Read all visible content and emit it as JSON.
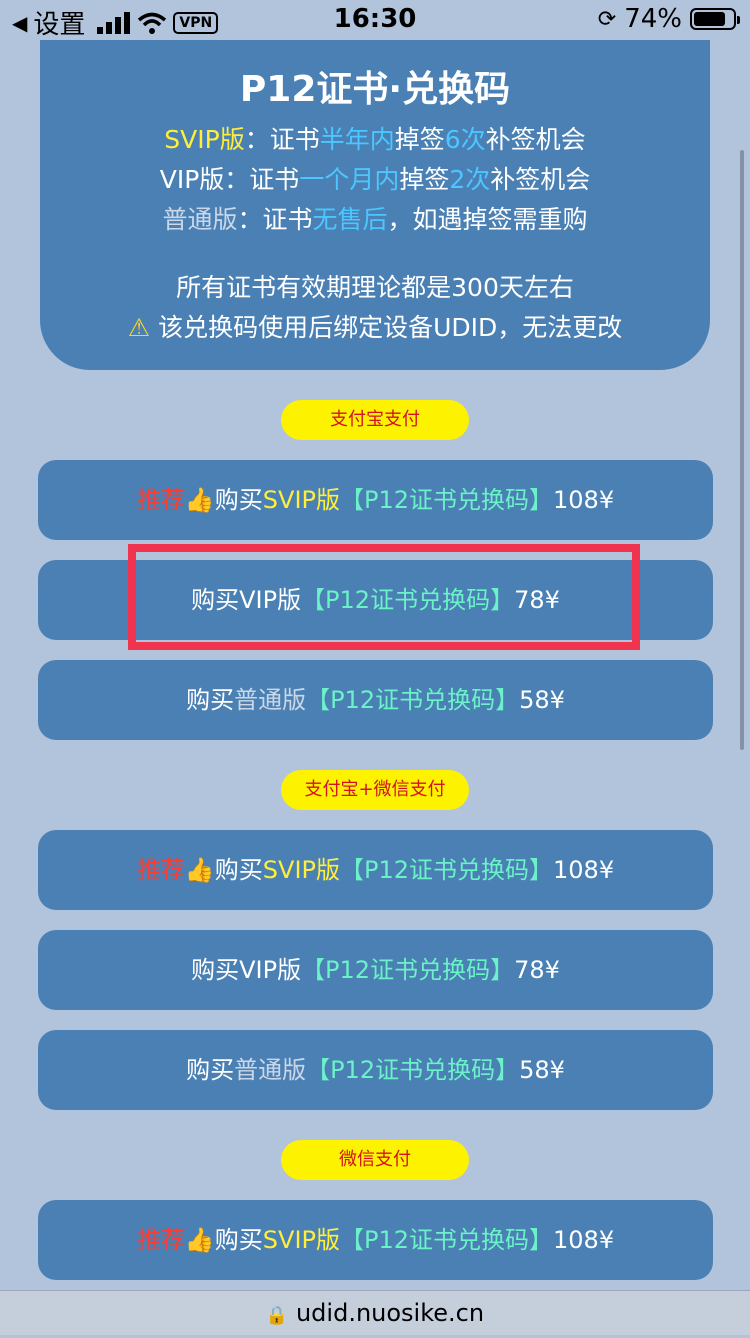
{
  "status": {
    "back_label": "设置",
    "time": "16:30",
    "vpn": "VPN",
    "battery": "74%"
  },
  "info": {
    "title": "P12证书·兑换码",
    "svip": {
      "prefix": "SVIP版",
      "colon": "：证书",
      "hl1": "半年内",
      "mid": "掉签",
      "hl2": "6次",
      "suffix": "补签机会"
    },
    "vip": {
      "prefix": "VIP版",
      "colon": "：证书",
      "hl1": "一个月内",
      "mid": "掉签",
      "hl2": "2次",
      "suffix": "补签机会"
    },
    "normal": {
      "prefix": "普通版",
      "colon": "：证书",
      "hl1": "无售后",
      "suffix": "，如遇掉签需重购"
    },
    "validity": "所有证书有效期理论都是300天左右",
    "warning": "该兑换码使用后绑定设备UDID，无法更改"
  },
  "sections": {
    "alipay": "支付宝支付",
    "alipay_wechat": "支付宝+微信支付",
    "wechat": "微信支付"
  },
  "buttons": {
    "recommend": "推荐",
    "buy": "购买",
    "svip": "SVIP版",
    "vip": "VIP版",
    "normal": "普通版",
    "code": "【P12证书兑换码】",
    "price_svip": "108¥",
    "price_vip": "78¥",
    "price_normal": "58¥"
  },
  "url": "udid.nuosike.cn"
}
